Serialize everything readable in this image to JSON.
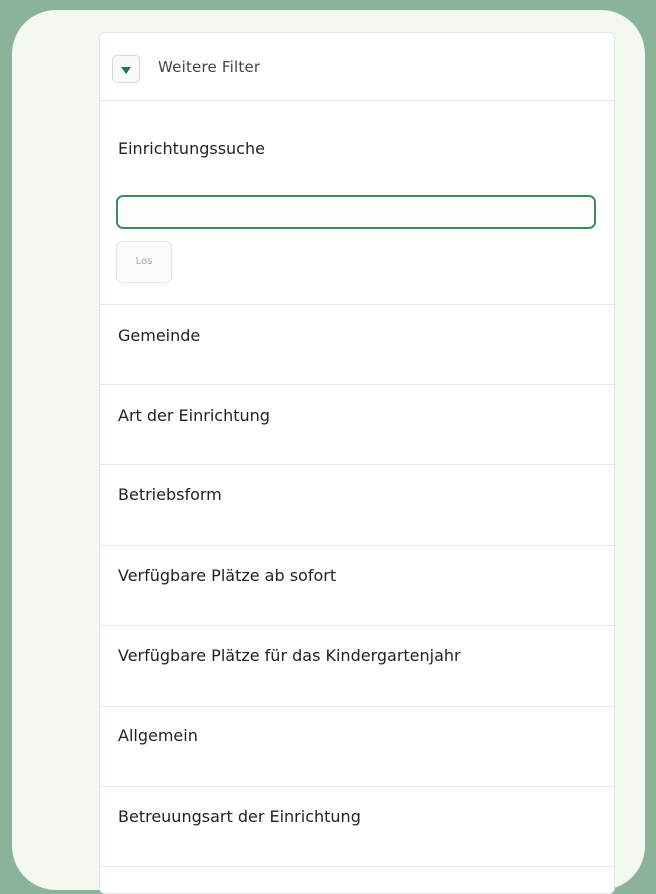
{
  "filter_toggle": {
    "label": "Weitere Filter",
    "icon": "caret-down-icon",
    "icon_color": "#1f7a4a"
  },
  "search": {
    "title": "Einrichtungssuche",
    "value": "",
    "placeholder": "",
    "button_label": "Los"
  },
  "filter_sections": [
    {
      "label": "Gemeinde"
    },
    {
      "label": "Art der Einrichtung"
    },
    {
      "label": "Betriebsform"
    },
    {
      "label": "Verfügbare Plätze ab sofort"
    },
    {
      "label": "Verfügbare Plätze für das Kindergartenjahr"
    },
    {
      "label": "Allgemein"
    },
    {
      "label": "Betreuungsart der Einrichtung"
    }
  ],
  "colors": {
    "background": "#8bb39a",
    "frame": "#f3f8f1",
    "accent": "#3d8a5a"
  }
}
